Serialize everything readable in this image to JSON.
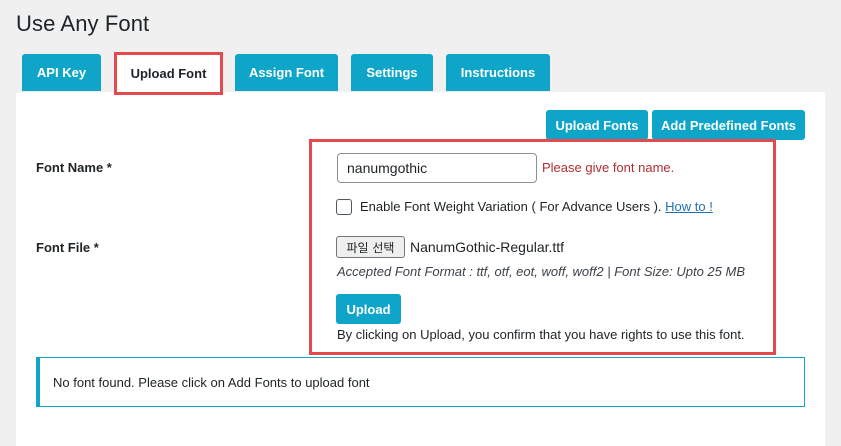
{
  "page": {
    "title": "Use Any Font"
  },
  "tabs": [
    {
      "label": "API Key",
      "active": false
    },
    {
      "label": "Upload Font",
      "active": true
    },
    {
      "label": "Assign Font",
      "active": false
    },
    {
      "label": "Settings",
      "active": false
    },
    {
      "label": "Instructions",
      "active": false
    }
  ],
  "actions": {
    "upload_fonts": "Upload Fonts",
    "add_predefined_fonts": "Add Predefined Fonts"
  },
  "form": {
    "font_name_label": "Font Name *",
    "font_name_value": "nanumgothic",
    "font_name_error": "Please give font name.",
    "weight_variation_label": "Enable Font Weight Variation ( For Advance Users ).",
    "weight_variation_checked": false,
    "how_to_link": "How to !",
    "font_file_label": "Font File *",
    "choose_file_button": "파일 선택",
    "chosen_file": "NanumGothic-Regular.ttf",
    "accepted_formats": "Accepted Font Format : ttf, otf, eot, woff, woff2 | Font Size: Upto 25 MB",
    "upload_button": "Upload",
    "confirm_text": "By clicking on Upload, you confirm that you have rights to use this font."
  },
  "notice": {
    "message": "No font found. Please click on Add Fonts to upload font"
  },
  "colors": {
    "accent": "#0ea5c9",
    "highlight": "#e5484d",
    "error": "#b32d2e",
    "link": "#2271b1"
  }
}
